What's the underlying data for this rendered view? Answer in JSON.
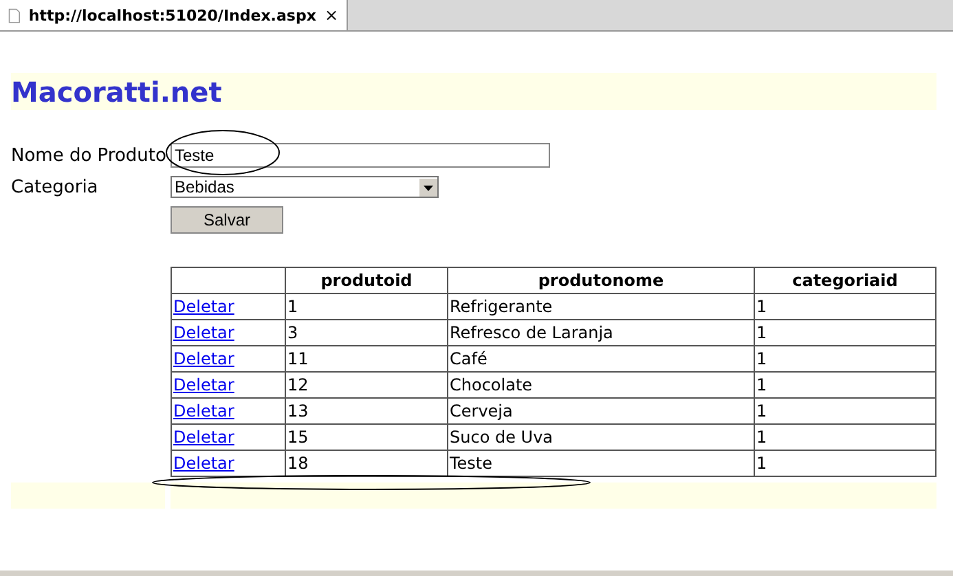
{
  "tab": {
    "title": "http://localhost:51020/Index.aspx",
    "close": "×"
  },
  "heading": "Macoratti.net",
  "form": {
    "name_label": "Nome do Produto",
    "name_value": "Teste",
    "category_label": "Categoria",
    "category_value": "Bebidas",
    "save": "Salvar"
  },
  "table": {
    "columns": [
      "produtoid",
      "produtonome",
      "categoriaid"
    ],
    "rows": [
      {
        "action": "Deletar",
        "cells": [
          "1",
          "Refrigerante",
          "1"
        ]
      },
      {
        "action": "Deletar",
        "cells": [
          "3",
          "Refresco de Laranja",
          "1"
        ]
      },
      {
        "action": "Deletar",
        "cells": [
          "11",
          "Café",
          "1"
        ]
      },
      {
        "action": "Deletar",
        "cells": [
          "12",
          "Chocolate",
          "1"
        ]
      },
      {
        "action": "Deletar",
        "cells": [
          "13",
          "Cerveja",
          "1"
        ]
      },
      {
        "action": "Deletar",
        "cells": [
          "15",
          "Suco de Uva",
          "1"
        ]
      },
      {
        "action": "Deletar",
        "cells": [
          "18",
          "Teste",
          "1"
        ]
      }
    ]
  }
}
